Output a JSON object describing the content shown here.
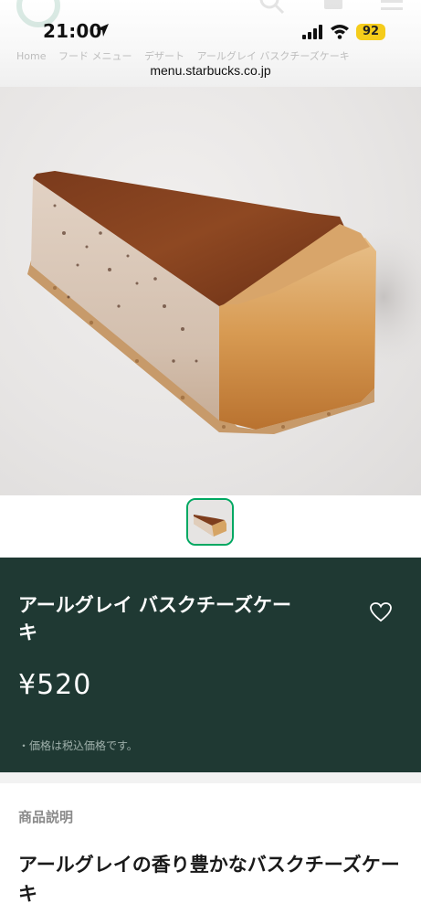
{
  "status_bar": {
    "time": "21:00",
    "battery": "92"
  },
  "breadcrumb_ghost": [
    "Home",
    "フード メニュー",
    "デザート",
    "アールグレイ バスクチーズケーキ"
  ],
  "browser": {
    "url": "menu.starbucks.co.jp"
  },
  "product": {
    "name": "アールグレイ バスクチーズケーキ",
    "price": "¥520",
    "tax_note": "・価格は税込価格です。"
  },
  "description": {
    "heading": "商品説明",
    "title": "アールグレイの香り豊かなバスクチーズケーキ"
  },
  "icons": {
    "location": "location-arrow-icon",
    "signal": "cellular-signal-icon",
    "wifi": "wifi-icon",
    "favorite": "heart-icon"
  },
  "colors": {
    "panel_bg": "#1f3933",
    "accent_green": "#00a862",
    "battery": "#f5cc1b"
  }
}
